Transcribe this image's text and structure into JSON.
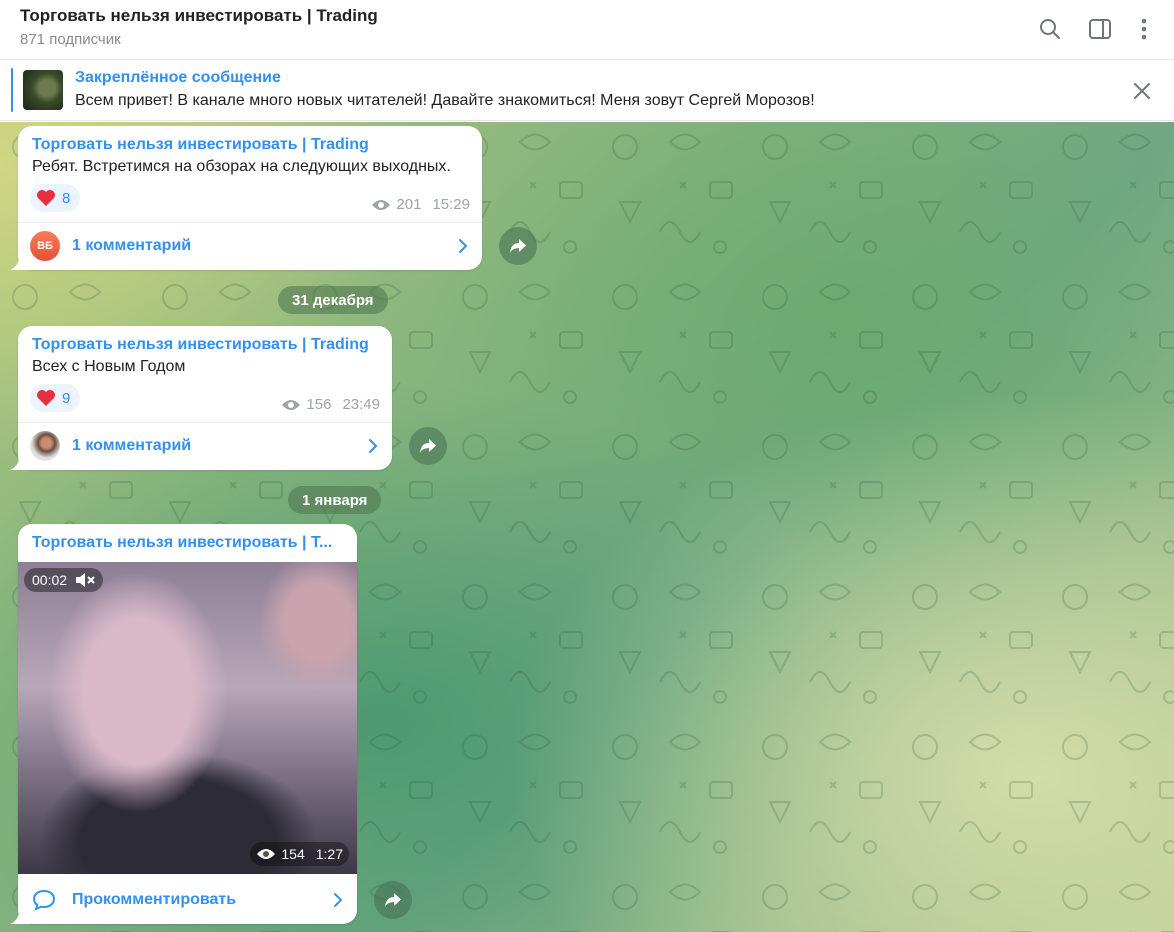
{
  "header": {
    "title": "Торговать нельзя инвестировать | Trading",
    "subtitle": "871 подписчик"
  },
  "pinned": {
    "title": "Закреплённое сообщение",
    "text": "Всем привет! В канале много новых читателей! Давайте знакомиться! Меня зовут Сергей Морозов!"
  },
  "messages": [
    {
      "author": "Торговать нельзя инвестировать | Trading",
      "text": "Ребят. Встретимся на обзорах на следующих выходных.",
      "reaction_count": "8",
      "views": "201",
      "time": "15:29",
      "comments_label": "1 комментарий",
      "avatar_initials": "ВБ"
    },
    {
      "author": "Торговать нельзя инвестировать | Trading",
      "text": "Всех с Новым Годом",
      "reaction_count": "9",
      "views": "156",
      "time": "23:49",
      "comments_label": "1 комментарий"
    },
    {
      "author": "Торговать нельзя инвестировать | T...",
      "video_time": "00:02",
      "views": "154",
      "time": "1:27",
      "comments_label": "Прокомментировать"
    }
  ],
  "dates": [
    "31 декабря",
    "1 января"
  ],
  "colors": {
    "accent": "#3390ec",
    "heart": "#e5303f"
  }
}
